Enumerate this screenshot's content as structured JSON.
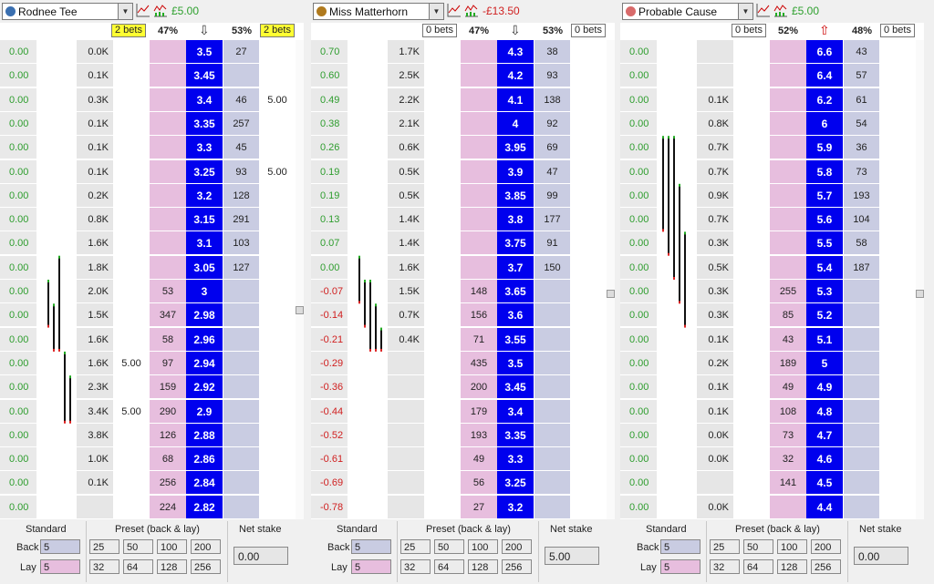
{
  "panels": [
    {
      "runner": "Rodnee Tee",
      "silk_color": "#3a6fb0",
      "pl": "£5.00",
      "pl_color": "#2ea02e",
      "back_bets": "2 bets",
      "back_bets_hl": true,
      "back_pct": "47%",
      "arrow": "⇩",
      "arrow_color": "#333",
      "lay_pct": "53%",
      "lay_bets": "2 bets",
      "lay_bets_hl": true,
      "rows": [
        {
          "pl": "0.00",
          "trd": "0.0K",
          "mb": "",
          "back": "",
          "price": "3.5",
          "lay": "27",
          "ml": "",
          "yb": 0
        },
        {
          "pl": "0.00",
          "trd": "0.1K",
          "mb": "",
          "back": "",
          "price": "3.45",
          "lay": "",
          "ml": "",
          "yb": 0
        },
        {
          "pl": "0.00",
          "trd": "0.3K",
          "mb": "",
          "back": "",
          "price": "3.4",
          "lay": "46",
          "ml": "5.00",
          "yb": 5
        },
        {
          "pl": "0.00",
          "trd": "0.1K",
          "mb": "",
          "back": "",
          "price": "3.35",
          "lay": "257",
          "ml": "",
          "yb": 0
        },
        {
          "pl": "0.00",
          "trd": "0.1K",
          "mb": "",
          "back": "",
          "price": "3.3",
          "lay": "45",
          "ml": "",
          "yb": 4
        },
        {
          "pl": "0.00",
          "trd": "0.1K",
          "mb": "",
          "back": "",
          "price": "3.25",
          "lay": "93",
          "ml": "5.00",
          "yb": 4
        },
        {
          "pl": "0.00",
          "trd": "0.2K",
          "mb": "",
          "back": "",
          "price": "3.2",
          "lay": "128",
          "ml": "",
          "yb": 4
        },
        {
          "pl": "0.00",
          "trd": "0.8K",
          "mb": "",
          "back": "",
          "price": "3.15",
          "lay": "291",
          "ml": "",
          "yb": 6
        },
        {
          "pl": "0.00",
          "trd": "1.6K",
          "mb": "",
          "back": "",
          "price": "3.1",
          "lay": "103",
          "ml": "",
          "yb": 13
        },
        {
          "pl": "0.00",
          "trd": "1.8K",
          "mb": "",
          "back": "",
          "price": "3.05",
          "lay": "127",
          "ml": "",
          "yb": 15
        },
        {
          "pl": "0.00",
          "trd": "2.0K",
          "mb": "",
          "back": "53",
          "price": "3",
          "lay": "",
          "ml": "",
          "yb": 16
        },
        {
          "pl": "0.00",
          "trd": "1.5K",
          "mb": "",
          "back": "347",
          "price": "2.98",
          "lay": "",
          "ml": "",
          "yb": 12
        },
        {
          "pl": "0.00",
          "trd": "1.6K",
          "mb": "",
          "back": "58",
          "price": "2.96",
          "lay": "",
          "ml": "",
          "yb": 13
        },
        {
          "pl": "0.00",
          "trd": "1.6K",
          "mb": "5.00",
          "back": "97",
          "price": "2.94",
          "lay": "",
          "ml": "",
          "yb": 13
        },
        {
          "pl": "0.00",
          "trd": "2.3K",
          "mb": "",
          "back": "159",
          "price": "2.92",
          "lay": "",
          "ml": "",
          "yb": 18
        },
        {
          "pl": "0.00",
          "trd": "3.4K",
          "mb": "5.00",
          "back": "290",
          "price": "2.9",
          "lay": "",
          "ml": "",
          "yb": 27
        },
        {
          "pl": "0.00",
          "trd": "3.8K",
          "mb": "",
          "back": "126",
          "price": "2.88",
          "lay": "",
          "ml": "",
          "yb": 30
        },
        {
          "pl": "0.00",
          "trd": "1.0K",
          "mb": "",
          "back": "68",
          "price": "2.86",
          "lay": "",
          "ml": "",
          "yb": 8
        },
        {
          "pl": "0.00",
          "trd": "0.1K",
          "mb": "",
          "back": "256",
          "price": "2.84",
          "lay": "",
          "ml": "",
          "yb": 0
        },
        {
          "pl": "0.00",
          "trd": "",
          "mb": "",
          "back": "224",
          "price": "2.82",
          "lay": "",
          "ml": "",
          "yb": 0
        }
      ],
      "footer": {
        "standard": "Standard",
        "back_label": "Back",
        "lay_label": "Lay",
        "back_val": "5",
        "lay_val": "5",
        "preset": "Preset (back & lay)",
        "preset_back": [
          "25",
          "50",
          "100",
          "200"
        ],
        "preset_lay": [
          "32",
          "64",
          "128",
          "256"
        ],
        "net": "Net stake",
        "net_val": "0.00"
      }
    },
    {
      "runner": "Miss Matterhorn",
      "silk_color": "#b07a1e",
      "pl": "-£13.50",
      "pl_color": "#d02020",
      "back_bets": "0 bets",
      "back_bets_hl": false,
      "back_pct": "47%",
      "arrow": "⇩",
      "arrow_color": "#333",
      "lay_pct": "53%",
      "lay_bets": "0 bets",
      "lay_bets_hl": false,
      "rows": [
        {
          "pl": "0.70",
          "trd": "1.7K",
          "mb": "",
          "back": "",
          "price": "4.3",
          "lay": "38",
          "ml": "",
          "yb": 14
        },
        {
          "pl": "0.60",
          "trd": "2.5K",
          "mb": "",
          "back": "",
          "price": "4.2",
          "lay": "93",
          "ml": "",
          "yb": 20
        },
        {
          "pl": "0.49",
          "trd": "2.2K",
          "mb": "",
          "back": "",
          "price": "4.1",
          "lay": "138",
          "ml": "",
          "yb": 18
        },
        {
          "pl": "0.38",
          "trd": "2.1K",
          "mb": "",
          "back": "",
          "price": "4",
          "lay": "92",
          "ml": "",
          "yb": 17
        },
        {
          "pl": "0.26",
          "trd": "0.6K",
          "mb": "",
          "back": "",
          "price": "3.95",
          "lay": "69",
          "ml": "",
          "yb": 5
        },
        {
          "pl": "0.19",
          "trd": "0.5K",
          "mb": "",
          "back": "",
          "price": "3.9",
          "lay": "47",
          "ml": "",
          "yb": 4
        },
        {
          "pl": "0.19",
          "trd": "0.5K",
          "mb": "",
          "back": "",
          "price": "3.85",
          "lay": "99",
          "ml": "",
          "yb": 4
        },
        {
          "pl": "0.13",
          "trd": "1.4K",
          "mb": "",
          "back": "",
          "price": "3.8",
          "lay": "177",
          "ml": "",
          "yb": 11
        },
        {
          "pl": "0.07",
          "trd": "1.4K",
          "mb": "",
          "back": "",
          "price": "3.75",
          "lay": "91",
          "ml": "",
          "yb": 11
        },
        {
          "pl": "0.00",
          "trd": "1.6K",
          "mb": "",
          "back": "",
          "price": "3.7",
          "lay": "150",
          "ml": "",
          "yb": 13
        },
        {
          "pl": "-0.07",
          "trd": "1.5K",
          "mb": "",
          "back": "148",
          "price": "3.65",
          "lay": "",
          "ml": "",
          "yb": 12
        },
        {
          "pl": "-0.14",
          "trd": "0.7K",
          "mb": "",
          "back": "156",
          "price": "3.6",
          "lay": "",
          "ml": "",
          "yb": 6
        },
        {
          "pl": "-0.21",
          "trd": "0.4K",
          "mb": "",
          "back": "71",
          "price": "3.55",
          "lay": "",
          "ml": "",
          "yb": 3
        },
        {
          "pl": "-0.29",
          "trd": "",
          "mb": "",
          "back": "435",
          "price": "3.5",
          "lay": "",
          "ml": "",
          "yb": 0
        },
        {
          "pl": "-0.36",
          "trd": "",
          "mb": "",
          "back": "200",
          "price": "3.45",
          "lay": "",
          "ml": "",
          "yb": 0
        },
        {
          "pl": "-0.44",
          "trd": "",
          "mb": "",
          "back": "179",
          "price": "3.4",
          "lay": "",
          "ml": "",
          "yb": 0
        },
        {
          "pl": "-0.52",
          "trd": "",
          "mb": "",
          "back": "193",
          "price": "3.35",
          "lay": "",
          "ml": "",
          "yb": 0
        },
        {
          "pl": "-0.61",
          "trd": "",
          "mb": "",
          "back": "49",
          "price": "3.3",
          "lay": "",
          "ml": "",
          "yb": 0
        },
        {
          "pl": "-0.69",
          "trd": "",
          "mb": "",
          "back": "56",
          "price": "3.25",
          "lay": "",
          "ml": "",
          "yb": 0
        },
        {
          "pl": "-0.78",
          "trd": "",
          "mb": "",
          "back": "27",
          "price": "3.2",
          "lay": "",
          "ml": "",
          "yb": 0
        }
      ],
      "footer": {
        "standard": "Standard",
        "back_label": "Back",
        "lay_label": "Lay",
        "back_val": "5",
        "lay_val": "5",
        "preset": "Preset (back & lay)",
        "preset_back": [
          "25",
          "50",
          "100",
          "200"
        ],
        "preset_lay": [
          "32",
          "64",
          "128",
          "256"
        ],
        "net": "Net stake",
        "net_val": "5.00"
      }
    },
    {
      "runner": "Probable Cause",
      "silk_color": "#d86a6a",
      "pl": "£5.00",
      "pl_color": "#2ea02e",
      "back_bets": "0 bets",
      "back_bets_hl": false,
      "back_pct": "52%",
      "arrow": "⇧",
      "arrow_color": "#c00",
      "lay_pct": "48%",
      "lay_bets": "0 bets",
      "lay_bets_hl": false,
      "rows": [
        {
          "pl": "0.00",
          "trd": "",
          "mb": "",
          "back": "",
          "price": "6.6",
          "lay": "43",
          "ml": "",
          "yb": 0
        },
        {
          "pl": "0.00",
          "trd": "",
          "mb": "",
          "back": "",
          "price": "6.4",
          "lay": "57",
          "ml": "",
          "yb": 0
        },
        {
          "pl": "0.00",
          "trd": "0.1K",
          "mb": "",
          "back": "",
          "price": "6.2",
          "lay": "61",
          "ml": "",
          "yb": 0
        },
        {
          "pl": "0.00",
          "trd": "0.8K",
          "mb": "",
          "back": "",
          "price": "6",
          "lay": "54",
          "ml": "",
          "yb": 11
        },
        {
          "pl": "0.00",
          "trd": "0.7K",
          "mb": "",
          "back": "",
          "price": "5.9",
          "lay": "36",
          "ml": "",
          "yb": 10
        },
        {
          "pl": "0.00",
          "trd": "0.7K",
          "mb": "",
          "back": "",
          "price": "5.8",
          "lay": "73",
          "ml": "",
          "yb": 10
        },
        {
          "pl": "0.00",
          "trd": "0.9K",
          "mb": "",
          "back": "",
          "price": "5.7",
          "lay": "193",
          "ml": "",
          "yb": 13
        },
        {
          "pl": "0.00",
          "trd": "0.7K",
          "mb": "",
          "back": "",
          "price": "5.6",
          "lay": "104",
          "ml": "",
          "yb": 10
        },
        {
          "pl": "0.00",
          "trd": "0.3K",
          "mb": "",
          "back": "",
          "price": "5.5",
          "lay": "58",
          "ml": "",
          "yb": 4
        },
        {
          "pl": "0.00",
          "trd": "0.5K",
          "mb": "",
          "back": "",
          "price": "5.4",
          "lay": "187",
          "ml": "",
          "yb": 7
        },
        {
          "pl": "0.00",
          "trd": "0.3K",
          "mb": "",
          "back": "255",
          "price": "5.3",
          "lay": "",
          "ml": "",
          "yb": 4
        },
        {
          "pl": "0.00",
          "trd": "0.3K",
          "mb": "",
          "back": "85",
          "price": "5.2",
          "lay": "",
          "ml": "",
          "yb": 4
        },
        {
          "pl": "0.00",
          "trd": "0.1K",
          "mb": "",
          "back": "43",
          "price": "5.1",
          "lay": "",
          "ml": "",
          "yb": 2
        },
        {
          "pl": "0.00",
          "trd": "0.2K",
          "mb": "",
          "back": "189",
          "price": "5",
          "lay": "",
          "ml": "",
          "yb": 3
        },
        {
          "pl": "0.00",
          "trd": "0.1K",
          "mb": "",
          "back": "49",
          "price": "4.9",
          "lay": "",
          "ml": "",
          "yb": 2
        },
        {
          "pl": "0.00",
          "trd": "0.1K",
          "mb": "",
          "back": "108",
          "price": "4.8",
          "lay": "",
          "ml": "",
          "yb": 2
        },
        {
          "pl": "0.00",
          "trd": "0.0K",
          "mb": "",
          "back": "73",
          "price": "4.7",
          "lay": "",
          "ml": "",
          "yb": 0
        },
        {
          "pl": "0.00",
          "trd": "0.0K",
          "mb": "",
          "back": "32",
          "price": "4.6",
          "lay": "",
          "ml": "",
          "yb": 0
        },
        {
          "pl": "0.00",
          "trd": "",
          "mb": "",
          "back": "141",
          "price": "4.5",
          "lay": "",
          "ml": "",
          "yb": 0
        },
        {
          "pl": "0.00",
          "trd": "0.0K",
          "mb": "",
          "back": "",
          "price": "4.4",
          "lay": "",
          "ml": "",
          "yb": 0
        }
      ],
      "footer": {
        "standard": "Standard",
        "back_label": "Back",
        "lay_label": "Lay",
        "back_val": "5",
        "lay_val": "5",
        "preset": "Preset (back & lay)",
        "preset_back": [
          "25",
          "50",
          "100",
          "200"
        ],
        "preset_lay": [
          "32",
          "64",
          "128",
          "256"
        ],
        "net": "Net stake",
        "net_val": "0.00"
      }
    }
  ],
  "icons": {
    "chart": "line-chart-icon",
    "graph": "price-graph-icon"
  },
  "colors": {
    "price_bg": "#0000ee",
    "back_bg": "#e7bede",
    "lay_bg": "#c9cce2",
    "volume_bar": "#ffff33",
    "bets_hl": "#ffff33"
  }
}
